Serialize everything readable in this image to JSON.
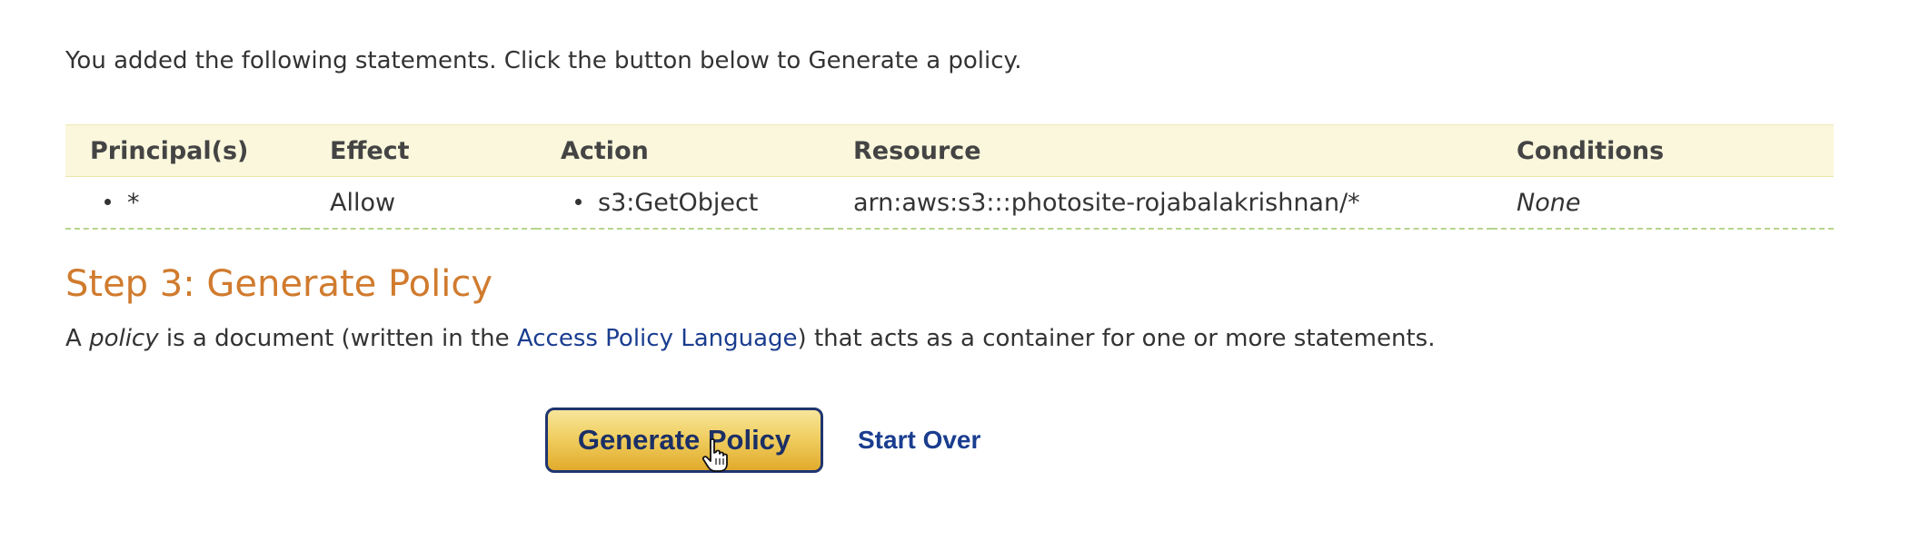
{
  "intro_text": "You added the following statements. Click the button below to Generate a policy.",
  "statements_table": {
    "columns": [
      "Principal(s)",
      "Effect",
      "Action",
      "Resource",
      "Conditions"
    ],
    "rows": [
      {
        "principal": "*",
        "effect": "Allow",
        "action": "s3:GetObject",
        "resource": "arn:aws:s3:::photosite-rojabalakrishnan/*",
        "conditions": "None"
      }
    ]
  },
  "step3": {
    "heading": "Step 3: Generate Policy",
    "desc_prefix": "A ",
    "desc_italic": "policy",
    "desc_middle": " is a document (written in the ",
    "desc_link": "Access Policy Language",
    "desc_suffix": ") that acts as a container for one or more statements."
  },
  "buttons": {
    "generate_label": "Generate Policy",
    "start_over_label": "Start Over"
  },
  "colors": {
    "heading_orange": "#d07b2e",
    "link_blue": "#1a3d8f",
    "table_header_bg": "#faf7dc",
    "row_divider_green": "#b7d58e",
    "button_gold": "#f0cf62",
    "button_border": "#1f3570"
  },
  "icons": {
    "cursor": "hand-pointer-cursor-icon"
  }
}
